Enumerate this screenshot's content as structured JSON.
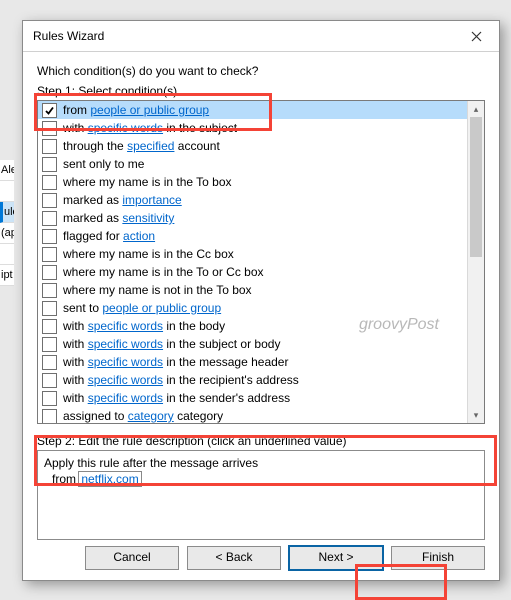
{
  "background": {
    "sidebar": [
      "Ale",
      "ule",
      "(ap",
      "ipt"
    ]
  },
  "watermark": "groovyPost",
  "dialog": {
    "title": "Rules Wizard",
    "prompt": "Which condition(s) do you want to check?",
    "step1_label": "Step 1: Select condition(s)",
    "step2_label": "Step 2: Edit the rule description (click an underlined value)",
    "description": {
      "line1": "Apply this rule after the message arrives",
      "from_prefix": "from ",
      "from_value": "netflix.com"
    },
    "buttons": {
      "cancel": "Cancel",
      "back": "< Back",
      "next": "Next >",
      "finish": "Finish"
    },
    "conditions": [
      {
        "checked": true,
        "selected": true,
        "pre": "from ",
        "link": "people or public group",
        "post": ""
      },
      {
        "checked": false,
        "selected": false,
        "pre": "with ",
        "link": "specific words",
        "post": " in the subject"
      },
      {
        "checked": false,
        "selected": false,
        "pre": "through the ",
        "link": "specified",
        "post": " account"
      },
      {
        "checked": false,
        "selected": false,
        "pre": "sent only to me",
        "link": "",
        "post": ""
      },
      {
        "checked": false,
        "selected": false,
        "pre": "where my name is in the To box",
        "link": "",
        "post": ""
      },
      {
        "checked": false,
        "selected": false,
        "pre": "marked as ",
        "link": "importance",
        "post": ""
      },
      {
        "checked": false,
        "selected": false,
        "pre": "marked as ",
        "link": "sensitivity",
        "post": ""
      },
      {
        "checked": false,
        "selected": false,
        "pre": "flagged for ",
        "link": "action",
        "post": ""
      },
      {
        "checked": false,
        "selected": false,
        "pre": "where my name is in the Cc box",
        "link": "",
        "post": ""
      },
      {
        "checked": false,
        "selected": false,
        "pre": "where my name is in the To or Cc box",
        "link": "",
        "post": ""
      },
      {
        "checked": false,
        "selected": false,
        "pre": "where my name is not in the To box",
        "link": "",
        "post": ""
      },
      {
        "checked": false,
        "selected": false,
        "pre": "sent to ",
        "link": "people or public group",
        "post": ""
      },
      {
        "checked": false,
        "selected": false,
        "pre": "with ",
        "link": "specific words",
        "post": " in the body"
      },
      {
        "checked": false,
        "selected": false,
        "pre": "with ",
        "link": "specific words",
        "post": " in the subject or body"
      },
      {
        "checked": false,
        "selected": false,
        "pre": "with ",
        "link": "specific words",
        "post": " in the message header"
      },
      {
        "checked": false,
        "selected": false,
        "pre": "with ",
        "link": "specific words",
        "post": " in the recipient's address"
      },
      {
        "checked": false,
        "selected": false,
        "pre": "with ",
        "link": "specific words",
        "post": " in the sender's address"
      },
      {
        "checked": false,
        "selected": false,
        "pre": "assigned to ",
        "link": "category",
        "post": " category"
      }
    ]
  }
}
